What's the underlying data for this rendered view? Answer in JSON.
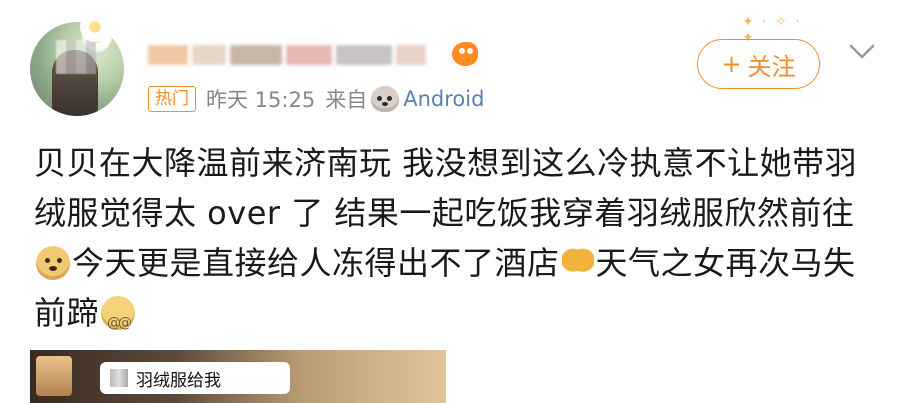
{
  "post": {
    "author": {
      "avatar_icon": "profile-avatar",
      "badge_icon": "daisy-badge-icon",
      "name_emoji_icon": "fox-emoji-icon"
    },
    "meta": {
      "tag": "热门",
      "time": "昨天 15:25",
      "source_prefix": "来自",
      "source_icon": "dog-icon",
      "source_name": "Android"
    },
    "follow_button": {
      "label": "关注",
      "plus": "+"
    },
    "more_icon": "chevron-down-icon",
    "content": {
      "seg1": "贝贝在大降温前来济南玩 我没想到这么冷执意不让她带羽绒服觉得太 over 了 结果一起吃饭我穿着羽绒服欣然前往",
      "emoji1": "doge-emoji-icon",
      "seg2": "今天更是直接给人冻得出不了酒店",
      "emoji2": "pray-emoji-icon",
      "seg3": "天气之女再次马失前蹄",
      "emoji3": "dizzy-emoji-icon"
    },
    "image_preview": {
      "caption": "羽绒服给我"
    }
  }
}
